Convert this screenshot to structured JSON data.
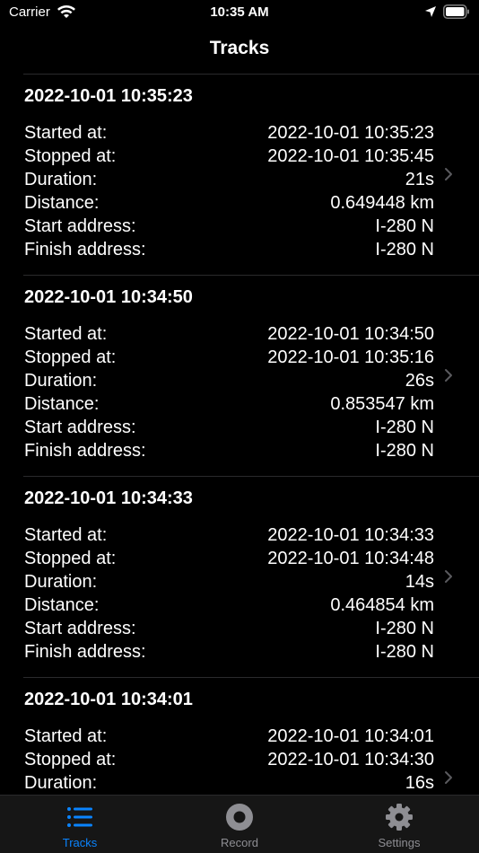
{
  "status": {
    "carrier": "Carrier",
    "time": "10:35 AM"
  },
  "nav": {
    "title": "Tracks"
  },
  "labels": {
    "started": "Started at:",
    "stopped": "Stopped at:",
    "duration": "Duration:",
    "distance": "Distance:",
    "start_address": "Start address:",
    "finish_address": "Finish address:"
  },
  "tracks": [
    {
      "title": "2022-10-01 10:35:23",
      "started": "2022-10-01 10:35:23",
      "stopped": "2022-10-01 10:35:45",
      "duration": "21s",
      "distance": "0.649448 km",
      "start_address": "I-280 N",
      "finish_address": "I-280 N"
    },
    {
      "title": "2022-10-01 10:34:50",
      "started": "2022-10-01 10:34:50",
      "stopped": "2022-10-01 10:35:16",
      "duration": "26s",
      "distance": "0.853547 km",
      "start_address": "I-280 N",
      "finish_address": "I-280 N"
    },
    {
      "title": "2022-10-01 10:34:33",
      "started": "2022-10-01 10:34:33",
      "stopped": "2022-10-01 10:34:48",
      "duration": "14s",
      "distance": "0.464854 km",
      "start_address": "I-280 N",
      "finish_address": "I-280 N"
    },
    {
      "title": "2022-10-01 10:34:01",
      "started": "2022-10-01 10:34:01",
      "stopped": "2022-10-01 10:34:30",
      "duration": "16s"
    }
  ],
  "tabs": [
    {
      "label": "Tracks",
      "icon": "list-icon"
    },
    {
      "label": "Record",
      "icon": "record-icon"
    },
    {
      "label": "Settings",
      "icon": "gear-icon"
    }
  ],
  "colors": {
    "accent": "#0a84ff",
    "inactive": "#8e8e93",
    "background": "#000000"
  }
}
